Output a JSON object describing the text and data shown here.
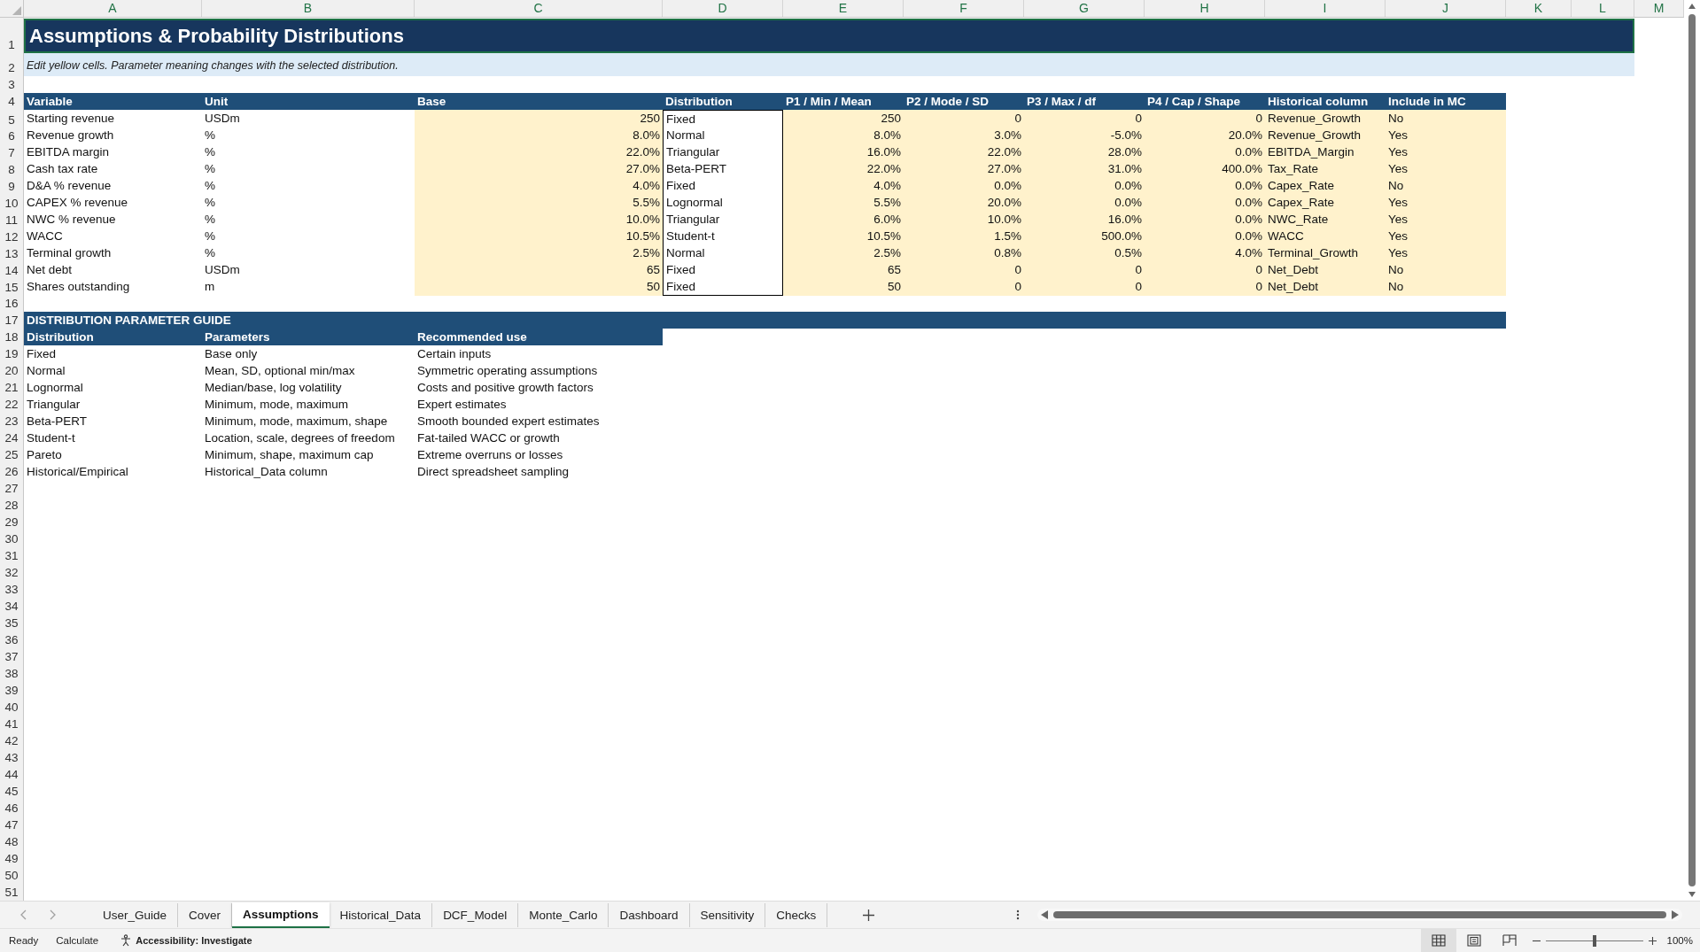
{
  "column_headers": [
    "A",
    "B",
    "C",
    "D",
    "E",
    "F",
    "G",
    "H",
    "I",
    "J",
    "K",
    "L",
    "M"
  ],
  "row_numbers": [
    "1",
    "2",
    "3",
    "4",
    "5",
    "6",
    "7",
    "8",
    "9",
    "10",
    "11",
    "12",
    "13",
    "14",
    "15",
    "16",
    "17",
    "18",
    "19",
    "20",
    "21",
    "22",
    "23",
    "24",
    "25",
    "26",
    "27",
    "28",
    "29",
    "30",
    "31",
    "32",
    "33",
    "34",
    "35",
    "36",
    "37",
    "38",
    "39",
    "40",
    "41",
    "42",
    "43",
    "44",
    "45",
    "46",
    "47",
    "48",
    "49",
    "50",
    "51"
  ],
  "title": "Assumptions & Probability Distributions",
  "note": "Edit yellow cells. Parameter meaning changes with the selected distribution.",
  "assumptions": {
    "columns": [
      "Variable",
      "Unit",
      "Base",
      "Distribution",
      "P1 / Min / Mean",
      "P2 / Mode / SD",
      "P3 / Max / df",
      "P4 / Cap / Shape",
      "Historical column",
      "Include in MC"
    ],
    "rows": [
      {
        "variable": "Starting revenue",
        "unit": "USDm",
        "base": "250",
        "distribution": "Fixed",
        "p1": "250",
        "p2": "0",
        "p3": "0",
        "p4": "0",
        "historical_column": "Revenue_Growth",
        "include_in_mc": "No"
      },
      {
        "variable": "Revenue growth",
        "unit": "%",
        "base": "8.0%",
        "distribution": "Normal",
        "p1": "8.0%",
        "p2": "3.0%",
        "p3": "-5.0%",
        "p4": "20.0%",
        "historical_column": "Revenue_Growth",
        "include_in_mc": "Yes"
      },
      {
        "variable": "EBITDA margin",
        "unit": "%",
        "base": "22.0%",
        "distribution": "Triangular",
        "p1": "16.0%",
        "p2": "22.0%",
        "p3": "28.0%",
        "p4": "0.0%",
        "historical_column": "EBITDA_Margin",
        "include_in_mc": "Yes"
      },
      {
        "variable": "Cash tax rate",
        "unit": "%",
        "base": "27.0%",
        "distribution": "Beta-PERT",
        "p1": "22.0%",
        "p2": "27.0%",
        "p3": "31.0%",
        "p4": "400.0%",
        "historical_column": "Tax_Rate",
        "include_in_mc": "Yes"
      },
      {
        "variable": "D&A % revenue",
        "unit": "%",
        "base": "4.0%",
        "distribution": "Fixed",
        "p1": "4.0%",
        "p2": "0.0%",
        "p3": "0.0%",
        "p4": "0.0%",
        "historical_column": "Capex_Rate",
        "include_in_mc": "No"
      },
      {
        "variable": "CAPEX % revenue",
        "unit": "%",
        "base": "5.5%",
        "distribution": "Lognormal",
        "p1": "5.5%",
        "p2": "20.0%",
        "p3": "0.0%",
        "p4": "0.0%",
        "historical_column": "Capex_Rate",
        "include_in_mc": "Yes"
      },
      {
        "variable": "NWC % revenue",
        "unit": "%",
        "base": "10.0%",
        "distribution": "Triangular",
        "p1": "6.0%",
        "p2": "10.0%",
        "p3": "16.0%",
        "p4": "0.0%",
        "historical_column": "NWC_Rate",
        "include_in_mc": "Yes"
      },
      {
        "variable": "WACC",
        "unit": "%",
        "base": "10.5%",
        "distribution": "Student-t",
        "p1": "10.5%",
        "p2": "1.5%",
        "p3": "500.0%",
        "p4": "0.0%",
        "historical_column": "WACC",
        "include_in_mc": "Yes"
      },
      {
        "variable": "Terminal growth",
        "unit": "%",
        "base": "2.5%",
        "distribution": "Normal",
        "p1": "2.5%",
        "p2": "0.8%",
        "p3": "0.5%",
        "p4": "4.0%",
        "historical_column": "Terminal_Growth",
        "include_in_mc": "Yes"
      },
      {
        "variable": "Net debt",
        "unit": "USDm",
        "base": "65",
        "distribution": "Fixed",
        "p1": "65",
        "p2": "0",
        "p3": "0",
        "p4": "0",
        "historical_column": "Net_Debt",
        "include_in_mc": "No"
      },
      {
        "variable": "Shares outstanding",
        "unit": "m",
        "base": "50",
        "distribution": "Fixed",
        "p1": "50",
        "p2": "0",
        "p3": "0",
        "p4": "0",
        "historical_column": "Net_Debt",
        "include_in_mc": "No"
      }
    ]
  },
  "guide": {
    "title": "DISTRIBUTION PARAMETER GUIDE",
    "columns": [
      "Distribution",
      "Parameters",
      "Recommended use"
    ],
    "rows": [
      {
        "distribution": "Fixed",
        "parameters": "Base only",
        "recommended_use": "Certain inputs"
      },
      {
        "distribution": "Normal",
        "parameters": "Mean, SD, optional min/max",
        "recommended_use": "Symmetric operating assumptions"
      },
      {
        "distribution": "Lognormal",
        "parameters": "Median/base, log volatility",
        "recommended_use": "Costs and positive growth factors"
      },
      {
        "distribution": "Triangular",
        "parameters": "Minimum, mode, maximum",
        "recommended_use": "Expert estimates"
      },
      {
        "distribution": "Beta-PERT",
        "parameters": "Minimum, mode, maximum, shape",
        "recommended_use": "Smooth bounded expert estimates"
      },
      {
        "distribution": "Student-t",
        "parameters": "Location, scale, degrees of freedom",
        "recommended_use": "Fat-tailed WACC or growth"
      },
      {
        "distribution": "Pareto",
        "parameters": "Minimum, shape, maximum cap",
        "recommended_use": "Extreme overruns or losses"
      },
      {
        "distribution": "Historical/Empirical",
        "parameters": "Historical_Data column",
        "recommended_use": "Direct spreadsheet sampling"
      }
    ]
  },
  "sheet_tabs": [
    {
      "label": "User_Guide",
      "selected": false
    },
    {
      "label": "Cover",
      "selected": false
    },
    {
      "label": "Assumptions",
      "selected": true
    },
    {
      "label": "Historical_Data",
      "selected": false
    },
    {
      "label": "DCF_Model",
      "selected": false
    },
    {
      "label": "Monte_Carlo",
      "selected": false
    },
    {
      "label": "Dashboard",
      "selected": false
    },
    {
      "label": "Sensitivity",
      "selected": false
    },
    {
      "label": "Checks",
      "selected": false
    }
  ],
  "status_bar": {
    "items": [
      "Ready",
      "Calculate"
    ],
    "accessibility": "Accessibility: Investigate",
    "view_buttons": [
      {
        "kind": "normal",
        "selected": true
      },
      {
        "kind": "page_layout",
        "selected": false
      },
      {
        "kind": "page_break",
        "selected": false
      }
    ],
    "zoom_slider": {
      "level": 0.5
    },
    "zoom": "100%"
  }
}
